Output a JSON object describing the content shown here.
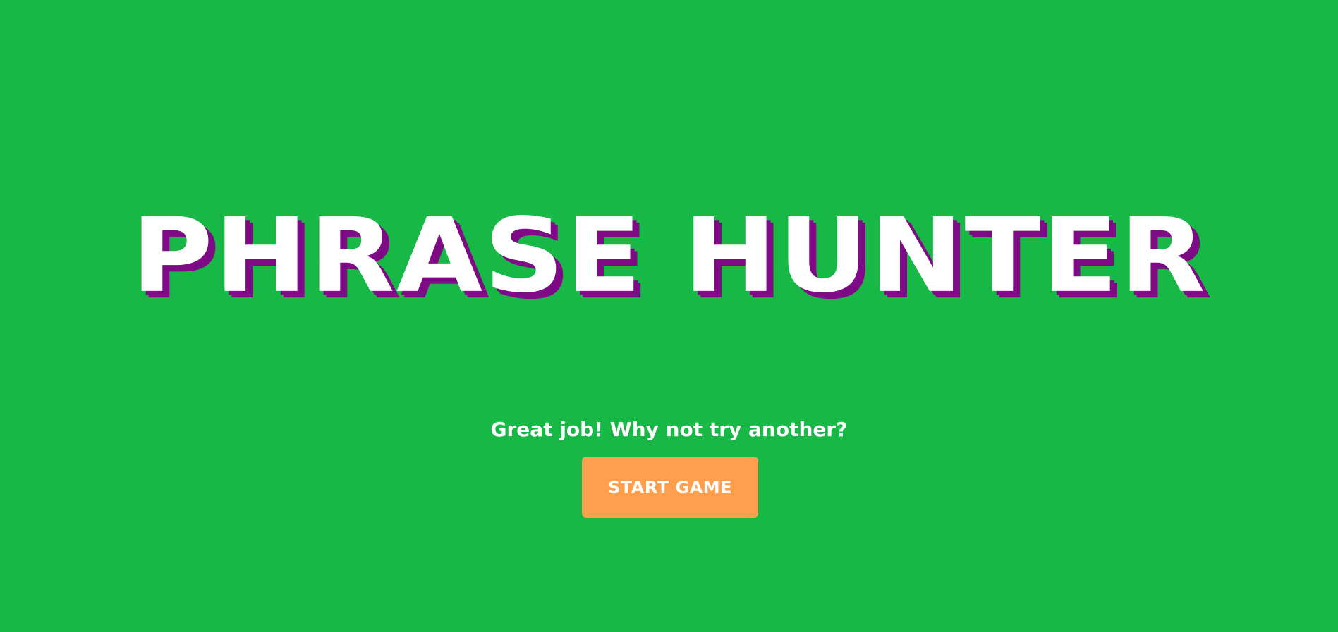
{
  "game": {
    "title": "PHRASE HUNTER",
    "message": "Great job! Why not try another?",
    "start_button_label": "START GAME"
  },
  "colors": {
    "background": "#18b846",
    "title_text": "#ffffff",
    "title_shadow": "#7e0a86",
    "button_background": "#ff9f4d"
  }
}
